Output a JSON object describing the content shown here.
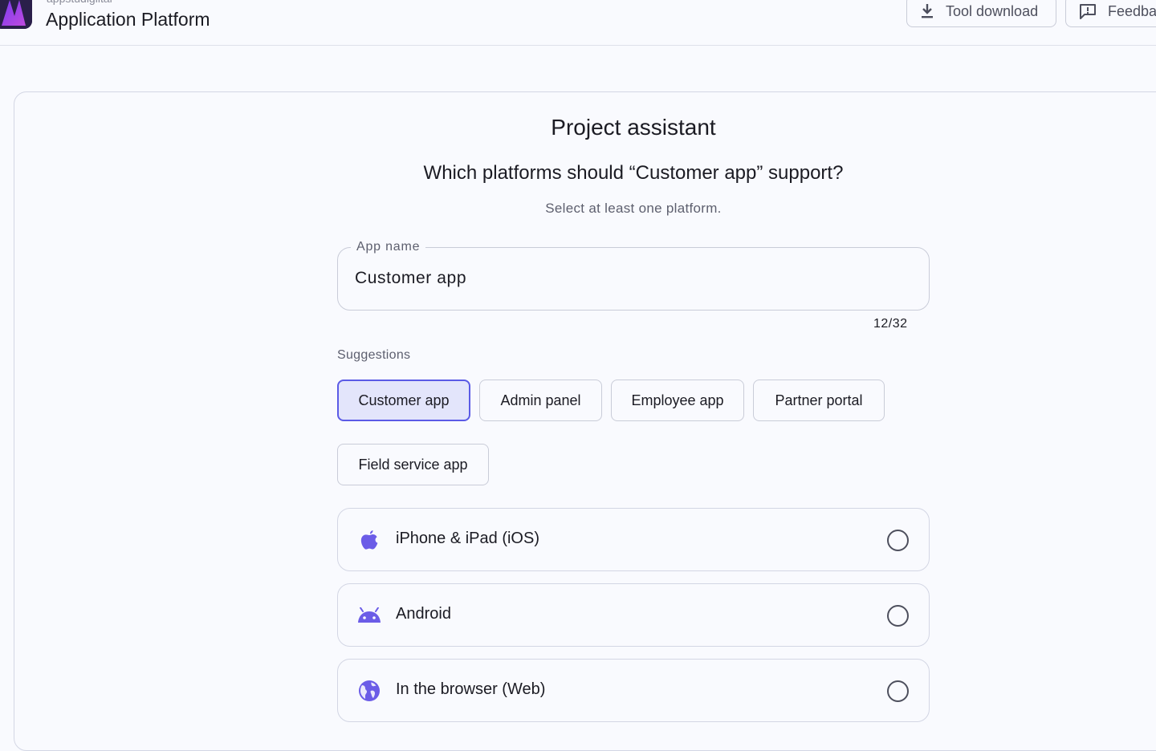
{
  "header": {
    "brand_subtitle": "appstudiglital",
    "app_title": "Application Platform",
    "download_label": "Tool download",
    "feedback_label": "Feedback"
  },
  "wizard": {
    "title": "Project assistant",
    "question": "Which platforms should “Customer app” support?",
    "hint": "Select at least one platform.",
    "app_name": {
      "label": "App name",
      "value": "Customer app",
      "counter": "12/32"
    },
    "suggestions_label": "Suggestions",
    "suggestions": [
      {
        "label": "Customer app",
        "selected": true
      },
      {
        "label": "Admin panel",
        "selected": false
      },
      {
        "label": "Employee app",
        "selected": false
      },
      {
        "label": "Partner portal",
        "selected": false
      },
      {
        "label": "Field service app",
        "selected": false
      }
    ],
    "platforms": [
      {
        "label": "iPhone & iPad (iOS)",
        "icon": "apple-icon",
        "checked": false
      },
      {
        "label": "Android",
        "icon": "android-icon",
        "checked": false
      },
      {
        "label": "In the browser (Web)",
        "icon": "globe-icon",
        "checked": false
      }
    ]
  },
  "colors": {
    "accent": "#5b5be6",
    "selected_chip_bg": "#e3e5fb",
    "icon_purple": "#6b5ce7",
    "background": "#f9fafe"
  }
}
